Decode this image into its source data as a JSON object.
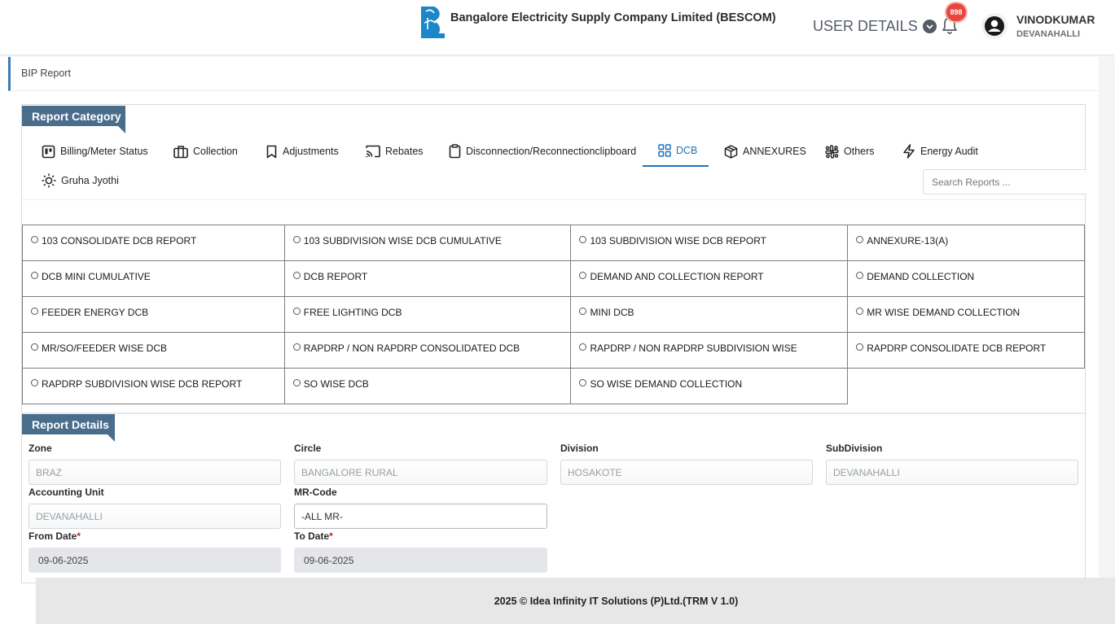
{
  "header": {
    "company": "Bangalore Electricity Supply Company Limited (BESCOM)",
    "user_details_label": "USER DETAILS",
    "notification_count": "898",
    "user_name": "VINODKUMAR",
    "user_location": "DEVANAHALLI",
    "logo_text": "BESCOM"
  },
  "breadcrumb": {
    "title": "BIP Report"
  },
  "report_category": {
    "heading": "Report Category",
    "tabs": [
      {
        "label": "Billing/Meter Status",
        "icon": "billing-icon"
      },
      {
        "label": "Collection",
        "icon": "briefcase-icon"
      },
      {
        "label": "Adjustments",
        "icon": "bookmark-icon"
      },
      {
        "label": "Rebates",
        "icon": "cast-icon"
      },
      {
        "label": "Disconnection/Reconnectionclipboard",
        "icon": "clipboard-icon"
      },
      {
        "label": "DCB",
        "icon": "grid-icon",
        "active": true
      },
      {
        "label": "ANNEXURES",
        "icon": "box-icon"
      },
      {
        "label": "Others",
        "icon": "slack-icon"
      },
      {
        "label": "Energy Audit",
        "icon": "lightning-icon"
      },
      {
        "label": "Gruha Jyothi",
        "icon": "sun-icon"
      }
    ],
    "search_placeholder": "Search Reports ...",
    "reports": [
      [
        "103 CONSOLIDATE DCB REPORT",
        "103 SUBDIVISION WISE DCB CUMULATIVE",
        "103 SUBDIVISION WISE DCB REPORT",
        "ANNEXURE-13(A)"
      ],
      [
        "DCB MINI CUMULATIVE",
        "DCB REPORT",
        "DEMAND AND COLLECTION REPORT",
        "DEMAND COLLECTION"
      ],
      [
        "FEEDER ENERGY DCB",
        "FREE LIGHTING DCB",
        "MINI DCB",
        "MR WISE DEMAND COLLECTION"
      ],
      [
        "MR/SO/FEEDER WISE DCB",
        "RAPDRP / NON RAPDRP CONSOLIDATED DCB",
        "RAPDRP / NON RAPDRP SUBDIVISION WISE",
        "RAPDRP CONSOLIDATE DCB REPORT"
      ],
      [
        "RAPDRP SUBDIVISION WISE DCB REPORT",
        "SO WISE DCB",
        "SO WISE DEMAND COLLECTION"
      ]
    ]
  },
  "report_details": {
    "heading": "Report Details",
    "zone": {
      "label": "Zone",
      "value": "BRAZ"
    },
    "circle": {
      "label": "Circle",
      "value": "BANGALORE RURAL"
    },
    "division": {
      "label": "Division",
      "value": "HOSAKOTE"
    },
    "subdivision": {
      "label": "SubDivision",
      "value": "DEVANAHALLI"
    },
    "accounting_unit": {
      "label": "Accounting Unit",
      "value": "DEVANAHALLI"
    },
    "mr_code": {
      "label": "MR-Code",
      "value": "-ALL MR-"
    },
    "from_date": {
      "label": "From Date",
      "value": "09-06-2025"
    },
    "to_date": {
      "label": "To Date",
      "value": "09-06-2025"
    },
    "required_mark": "*"
  },
  "footer": {
    "text": "2025 © Idea Infinity IT Solutions (P)Ltd.(TRM V 1.0)"
  },
  "colors": {
    "accent": "#1e73be",
    "ribbon": "#4a6d8c",
    "badge": "#e8453c"
  }
}
